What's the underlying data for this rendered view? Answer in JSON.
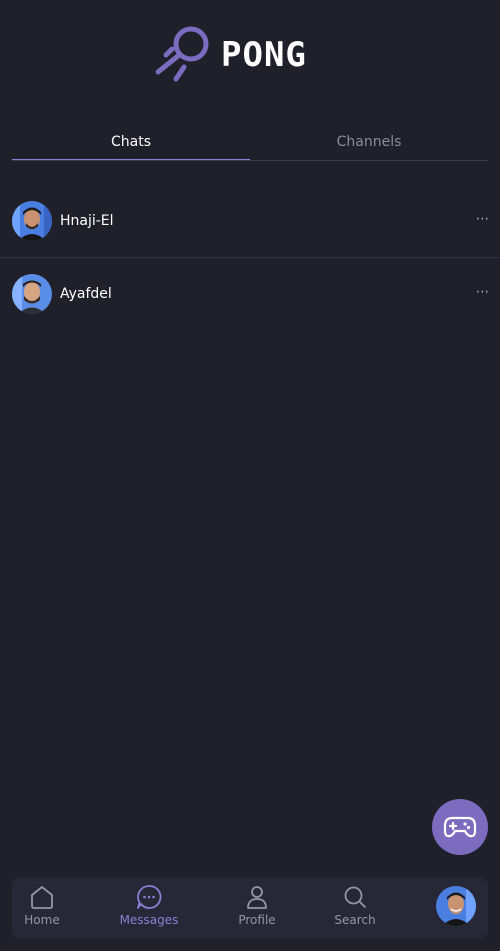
{
  "app": {
    "logo_text": "PONG"
  },
  "tabs": [
    {
      "label": "Chats",
      "active": true
    },
    {
      "label": "Channels",
      "active": false
    }
  ],
  "chats": [
    {
      "name": "Hnaji-El",
      "menu": "···"
    },
    {
      "name": "Ayafdel",
      "menu": "···"
    }
  ],
  "fab": {
    "icon": "gamepad-icon"
  },
  "nav": {
    "items": [
      {
        "label": "Home",
        "icon": "home-icon",
        "active": false
      },
      {
        "label": "Messages",
        "icon": "message-icon",
        "active": true
      },
      {
        "label": "Profile",
        "icon": "user-icon",
        "active": false
      },
      {
        "label": "Search",
        "icon": "search-icon",
        "active": false
      }
    ]
  },
  "colors": {
    "background": "#1f2029",
    "accent": "#8b7fd6",
    "fab": "#7b6cbf",
    "nav_bg": "#262837"
  }
}
